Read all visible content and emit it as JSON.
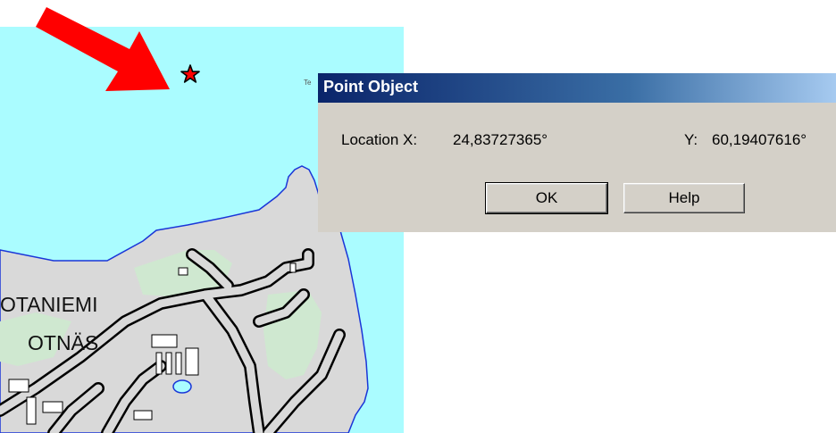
{
  "map": {
    "place_name_fi": "OTANIEMI",
    "place_name_sv": "OTNÄS",
    "tiny_label": "Te",
    "colors": {
      "water": "#aafcff",
      "land": "#d9d9d9",
      "park": "#cfe8d0",
      "coast": "#1a36d8",
      "road_casing": "#000000",
      "road_fill": "#d9d9d9"
    }
  },
  "annotation": {
    "arrow_color": "#ff0000",
    "star_color": "#ff0000"
  },
  "dialog": {
    "title": "Point Object",
    "location_x_label": "Location X:",
    "location_x_value": "24,83727365°",
    "location_y_label": "Y:",
    "location_y_value": "60,19407616°",
    "ok_label": "OK",
    "help_label": "Help"
  }
}
